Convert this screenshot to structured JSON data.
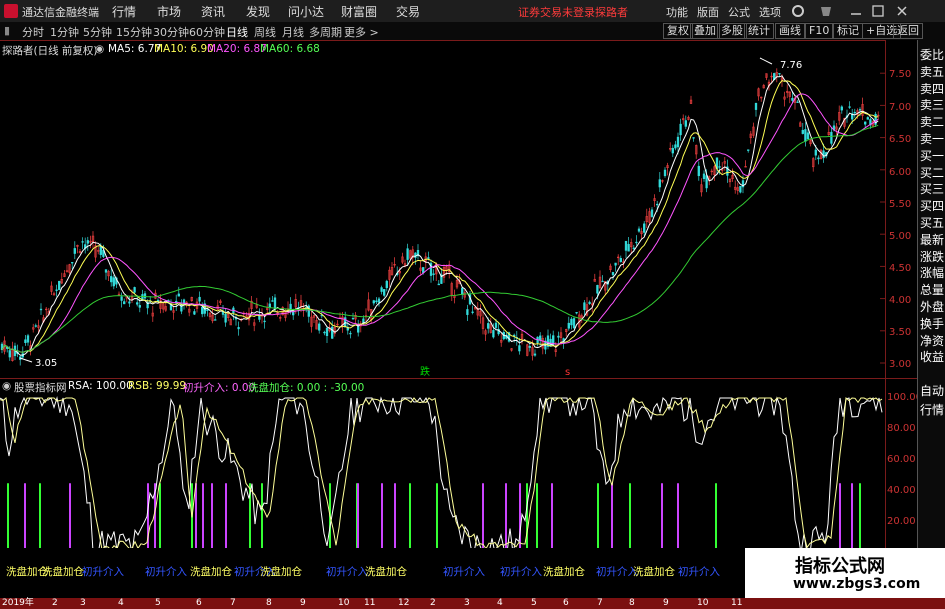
{
  "app": {
    "title": "通达信金融终端"
  },
  "menu": [
    "行情",
    "市场",
    "资讯",
    "发现",
    "问小达",
    "财富圈",
    "交易"
  ],
  "login_text": "证券交易未登录",
  "user": "探路者",
  "right_menu": [
    "功能",
    "版面",
    "公式",
    "选项"
  ],
  "periods": [
    "分时",
    "1分钟",
    "5分钟",
    "15分钟",
    "30分钟",
    "60分钟",
    "日线",
    "周线",
    "月线",
    "多周期",
    "更多 >"
  ],
  "selected_period": "日线",
  "right_tools": [
    "复权",
    "叠加",
    "多股",
    "统计",
    "画线",
    "F10",
    "标记",
    "+自选",
    "返回"
  ],
  "main_chart": {
    "name": "探路者(日线 前复权)",
    "ma": [
      {
        "label": "MA5: 6.77",
        "color": "#ffffff"
      },
      {
        "label": "MA10: 6.90",
        "color": "#ffff55"
      },
      {
        "label": "MA20: 6.87",
        "color": "#ff55ff"
      },
      {
        "label": "MA60: 6.68",
        "color": "#55ff55"
      }
    ],
    "high_label": "7.76",
    "low_label": "3.05",
    "marker_green": "跌",
    "marker_red": "s",
    "y_ticks": [
      "7.50",
      "7.00",
      "6.50",
      "6.00",
      "5.50",
      "5.00",
      "4.50",
      "4.00",
      "3.50",
      "3.00"
    ]
  },
  "indicator": {
    "name": "股票指标网",
    "rsa": "RSA: 100.00",
    "rsb": "RSB: 99.99",
    "cs": "初升介入: 0.00",
    "xp": "洗盘加仓: 0.00 : -30.00",
    "y_ticks": [
      "100.00",
      "80.00",
      "60.00",
      "40.00",
      "20.00"
    ]
  },
  "right_panel": [
    "委比",
    "卖五",
    "卖四",
    "卖三",
    "卖二",
    "卖一",
    "买一",
    "买二",
    "买三",
    "买四",
    "买五",
    "最新",
    "涨跌",
    "涨幅",
    "总量",
    "外盘",
    "换手",
    "净资",
    "收益",
    "自动",
    "行情"
  ],
  "bottom_labels": [
    {
      "text": "洗盘加仓",
      "color": "#ffff66"
    },
    {
      "text": "洗盘加仓",
      "color": "#ffff66"
    },
    {
      "text": "初升介入",
      "color": "#3355ff"
    },
    {
      "text": "初升介入",
      "color": "#3355ff"
    },
    {
      "text": "洗盘加仓",
      "color": "#ffff66"
    },
    {
      "text": "初升介入",
      "color": "#3355ff"
    },
    {
      "text": "洗盘加仓",
      "color": "#ffff66"
    },
    {
      "text": "初升介入",
      "color": "#3355ff"
    },
    {
      "text": "洗盘加仓",
      "color": "#ffff66"
    },
    {
      "text": "初升介入",
      "color": "#3355ff"
    },
    {
      "text": "初升介入",
      "color": "#3355ff"
    },
    {
      "text": "洗盘加仓",
      "color": "#ffff66"
    },
    {
      "text": "初升介入",
      "color": "#3355ff"
    },
    {
      "text": "洗盘加仓",
      "color": "#ffff66"
    },
    {
      "text": "初升介入",
      "color": "#3355ff"
    }
  ],
  "x_axis": [
    "2019年",
    "2",
    "3",
    "4",
    "5",
    "6",
    "7",
    "8",
    "9",
    "10",
    "11",
    "12",
    "2",
    "3",
    "4",
    "5",
    "6",
    "7",
    "8",
    "9",
    "10",
    "11",
    "12"
  ],
  "watermark": {
    "title": "指标公式网",
    "url": "www.zbgs3.com"
  }
}
